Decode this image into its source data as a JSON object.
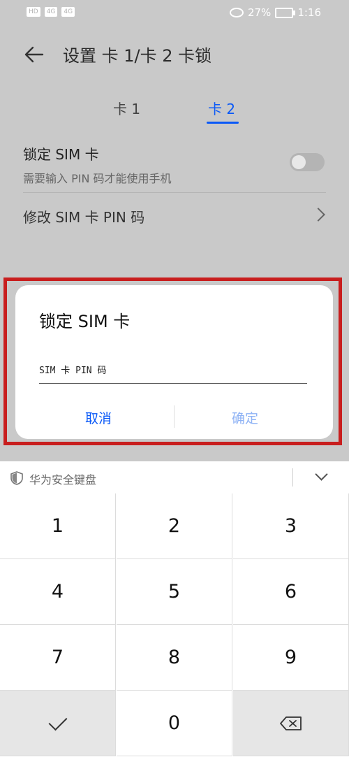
{
  "status_bar": {
    "left_chips": [
      "HD",
      "4G",
      "4G"
    ],
    "battery_percent": "27%",
    "time": "1:16"
  },
  "header": {
    "title": "设置 卡 1/卡 2 卡锁"
  },
  "tabs": [
    {
      "label": "卡 1",
      "selected": false
    },
    {
      "label": "卡 2",
      "selected": true
    }
  ],
  "settings": {
    "lock_sim": {
      "title": "锁定 SIM 卡",
      "subtitle": "需要输入 PIN 码才能使用手机",
      "enabled": false
    },
    "change_pin": {
      "title": "修改 SIM 卡 PIN 码"
    }
  },
  "dialog": {
    "title": "锁定 SIM 卡",
    "pin_placeholder": "SIM 卡 PIN 码",
    "pin_value": "",
    "cancel_label": "取消",
    "confirm_label": "确定"
  },
  "keyboard": {
    "brand": "华为安全键盘",
    "keys": [
      "1",
      "2",
      "3",
      "4",
      "5",
      "6",
      "7",
      "8",
      "9",
      "",
      "0",
      ""
    ]
  },
  "colors": {
    "accent": "#0a59f7",
    "highlight_border": "#c81e1e"
  },
  "icons": [
    "back-arrow-icon",
    "chevron-right-icon",
    "shield-icon",
    "chevron-down-icon",
    "checkmark-icon",
    "backspace-icon",
    "eye-icon",
    "battery-icon"
  ]
}
